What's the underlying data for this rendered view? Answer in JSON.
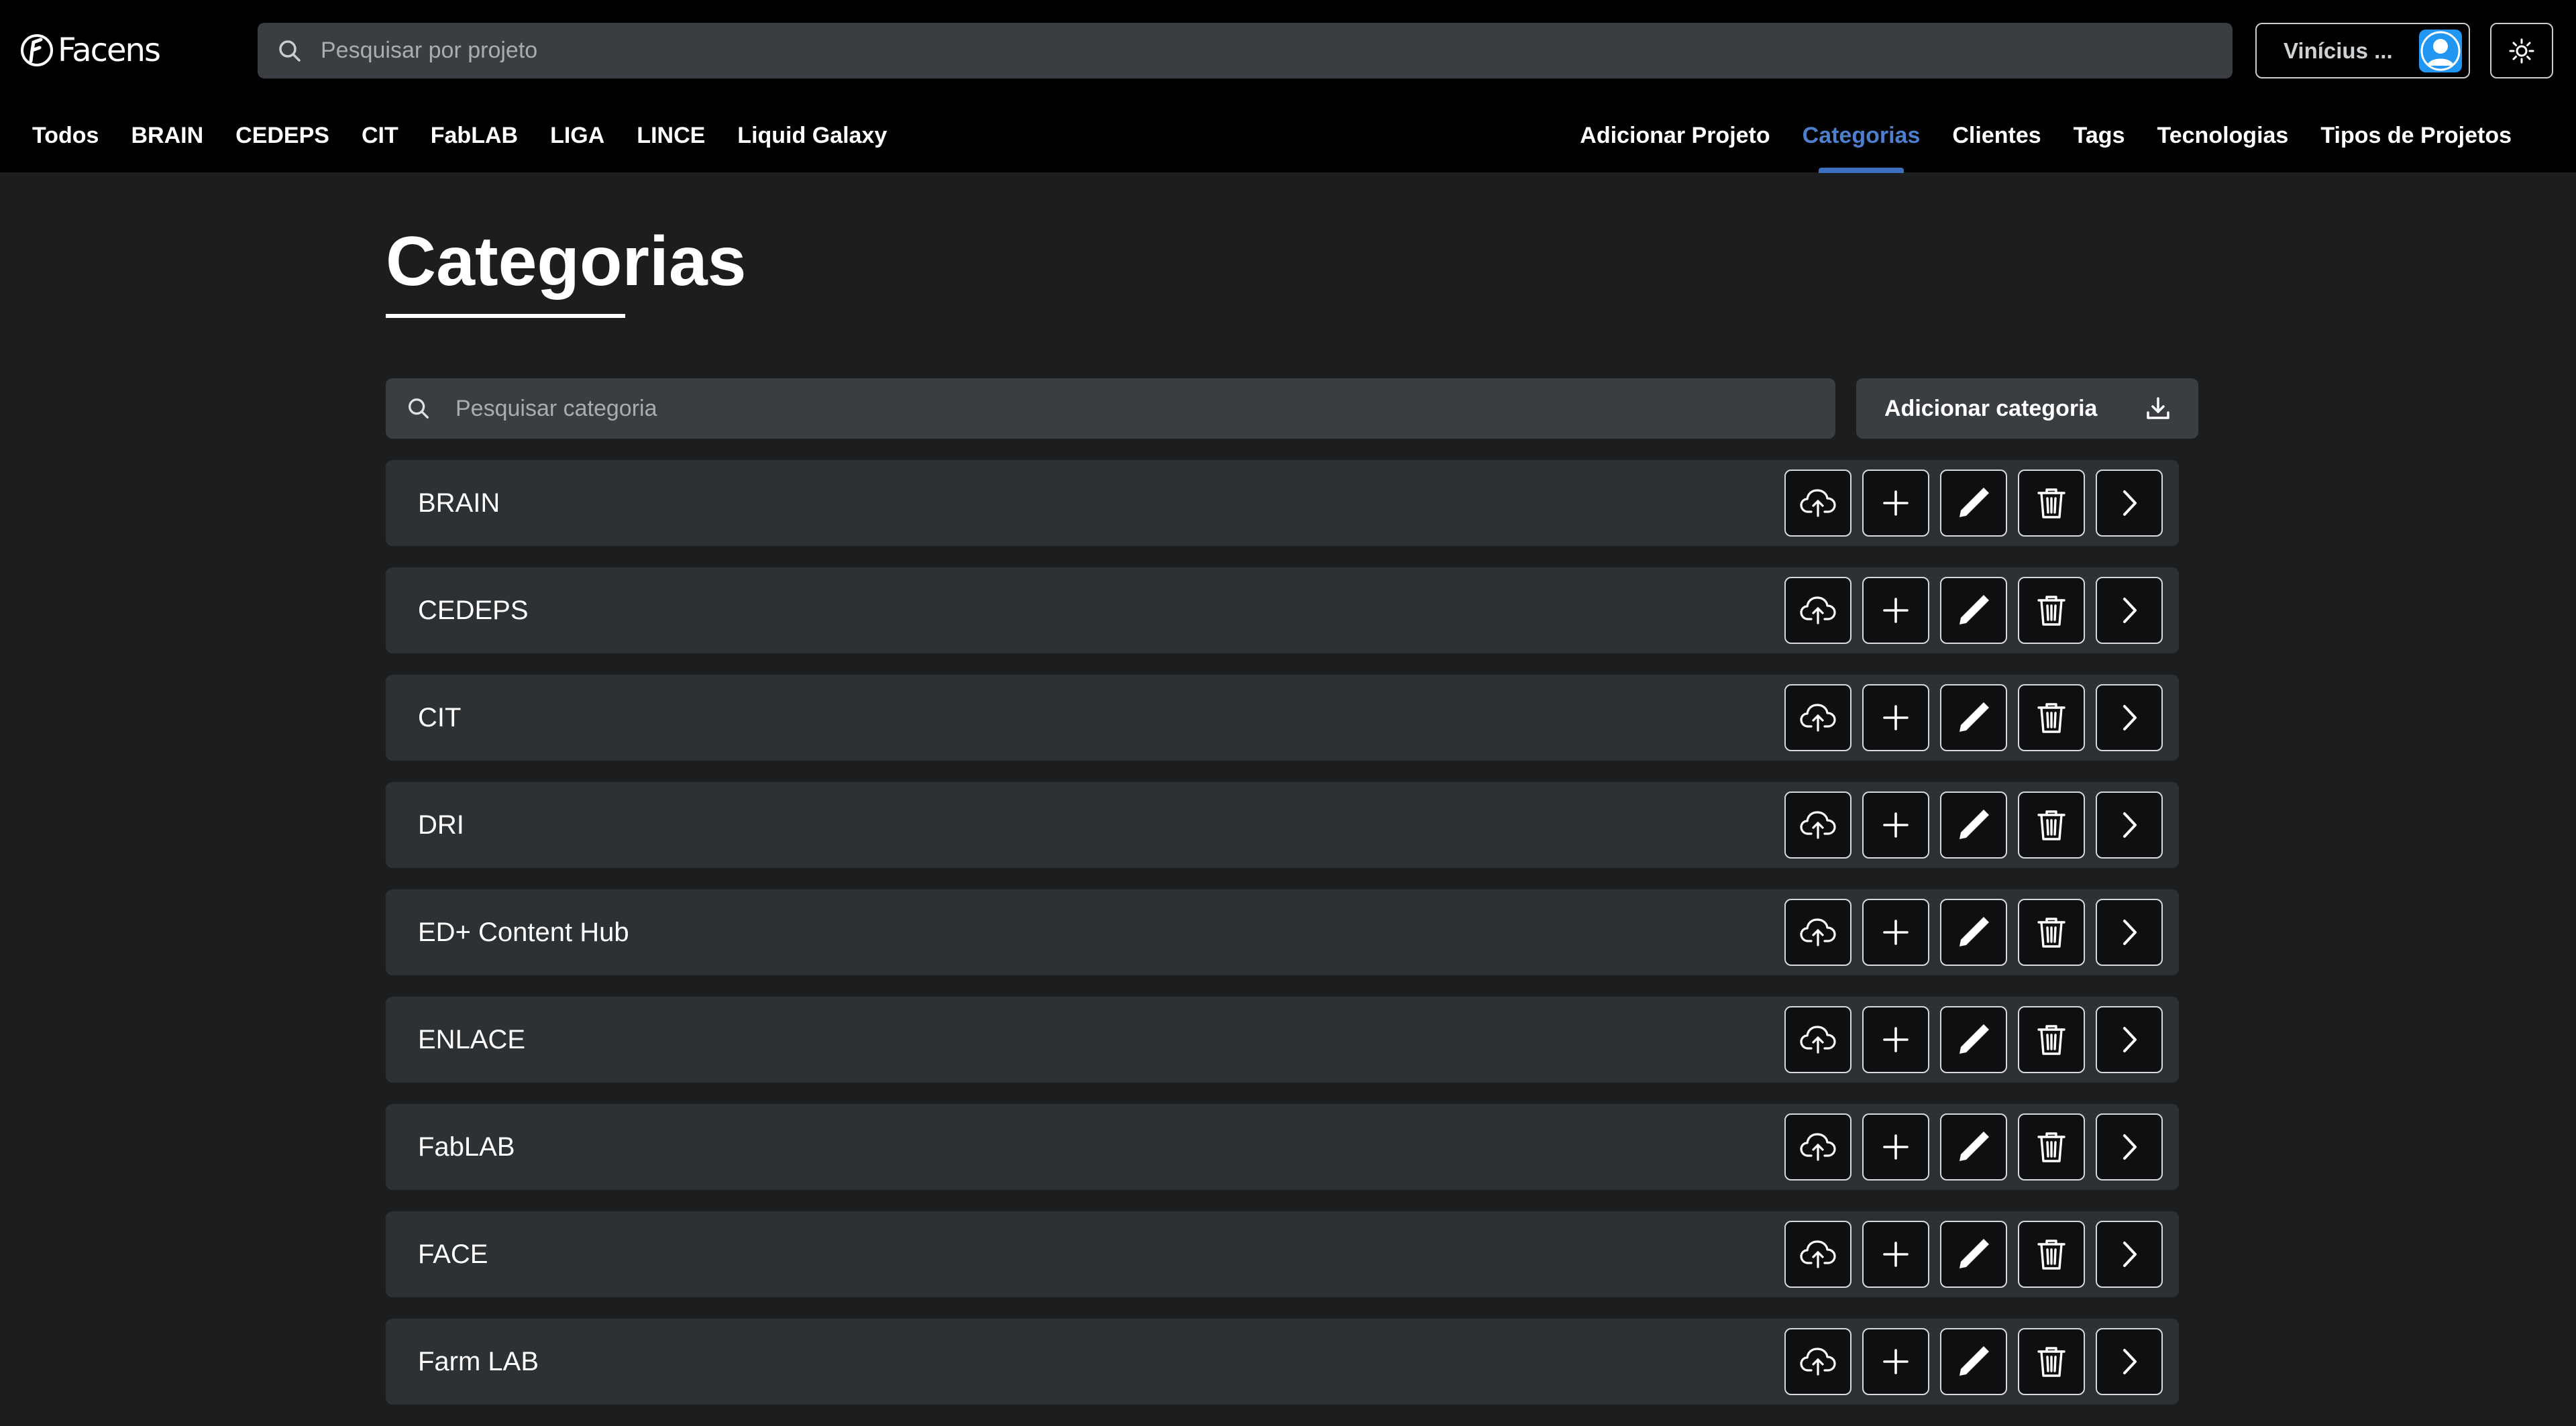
{
  "header": {
    "logo_text": "Facens",
    "search_placeholder": "Pesquisar por projeto",
    "user_name": "Vinícius ...",
    "nav_left": [
      "Todos",
      "BRAIN",
      "CEDEPS",
      "CIT",
      "FabLAB",
      "LIGA",
      "LINCE",
      "Liquid Galaxy"
    ],
    "nav_right": [
      "Adicionar Projeto",
      "Categorias",
      "Clientes",
      "Tags",
      "Tecnologias",
      "Tipos de Projetos"
    ],
    "active_nav": "Categorias"
  },
  "main": {
    "title": "Categorias",
    "search_placeholder": "Pesquisar categoria",
    "add_button_label": "Adicionar categoria",
    "categories": [
      "BRAIN",
      "CEDEPS",
      "CIT",
      "DRI",
      "ED+ Content Hub",
      "ENLACE",
      "FabLAB",
      "FACE",
      "Farm LAB"
    ],
    "row_actions": [
      "cloud-upload-icon",
      "plus-icon",
      "pencil-icon",
      "trash-icon",
      "chevron-right-icon"
    ]
  },
  "colors": {
    "header_bg": "#000000",
    "page_bg": "#1b1d1f",
    "row_bg": "#2e3134",
    "input_bg": "#3a3d41",
    "accent": "#4d7fcc",
    "avatar": "#2196f3"
  }
}
